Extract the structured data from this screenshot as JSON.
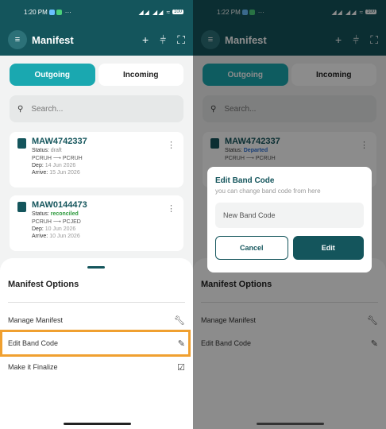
{
  "left": {
    "status": {
      "time": "1:20 PM",
      "dots": "···",
      "battery": "100"
    },
    "appbar": {
      "title": "Manifest"
    },
    "tabs": {
      "outgoing": "Outgoing",
      "incoming": "Incoming"
    },
    "search": {
      "placeholder": "Search..."
    },
    "cards": [
      {
        "awb": "MAW4742337",
        "status_label": "Status:",
        "status": "draft",
        "route_from": "PCRUH",
        "route_to": "PCRUH",
        "dep_label": "Dep:",
        "dep": "14 Jun 2026",
        "arrive_label": "Arrive:",
        "arrive": "15 Jun 2026"
      },
      {
        "awb": "MAW0144473",
        "status_label": "Status:",
        "status": "reconciled",
        "route_from": "PCRUH",
        "route_to": "PCJED",
        "dep_label": "Dep:",
        "dep": "10 Jun 2026",
        "arrive_label": "Arrive:",
        "arrive": "10 Jun 2026"
      }
    ],
    "sheet": {
      "title": "Manifest Options",
      "options": [
        "Manage Manifest",
        "Edit Band Code",
        "Make it Finalize"
      ]
    }
  },
  "right": {
    "status": {
      "time": "1:22 PM",
      "dots": "···",
      "battery": "100"
    },
    "appbar": {
      "title": "Manifest"
    },
    "tabs": {
      "outgoing": "Outgoing",
      "incoming": "Incoming"
    },
    "search": {
      "placeholder": "Search..."
    },
    "card": {
      "awb": "MAW4742337",
      "status_label": "Status:",
      "status": "Departed",
      "route_from": "PCRUH",
      "route_to": "PCRUH"
    },
    "dialog": {
      "title": "Edit Band Code",
      "subtitle": "you can change band code from here",
      "input_placeholder": "New Band Code",
      "cancel": "Cancel",
      "edit": "Edit"
    },
    "sheet": {
      "title": "Manifest Options",
      "options": [
        "Manage Manifest",
        "Edit Band Code"
      ]
    }
  },
  "colors": {
    "primary": "#14555c",
    "accent": "#1aa8b0",
    "highlight": "#f0a030",
    "reconciled": "#2c9a3c",
    "departed": "#2a6fd6"
  }
}
